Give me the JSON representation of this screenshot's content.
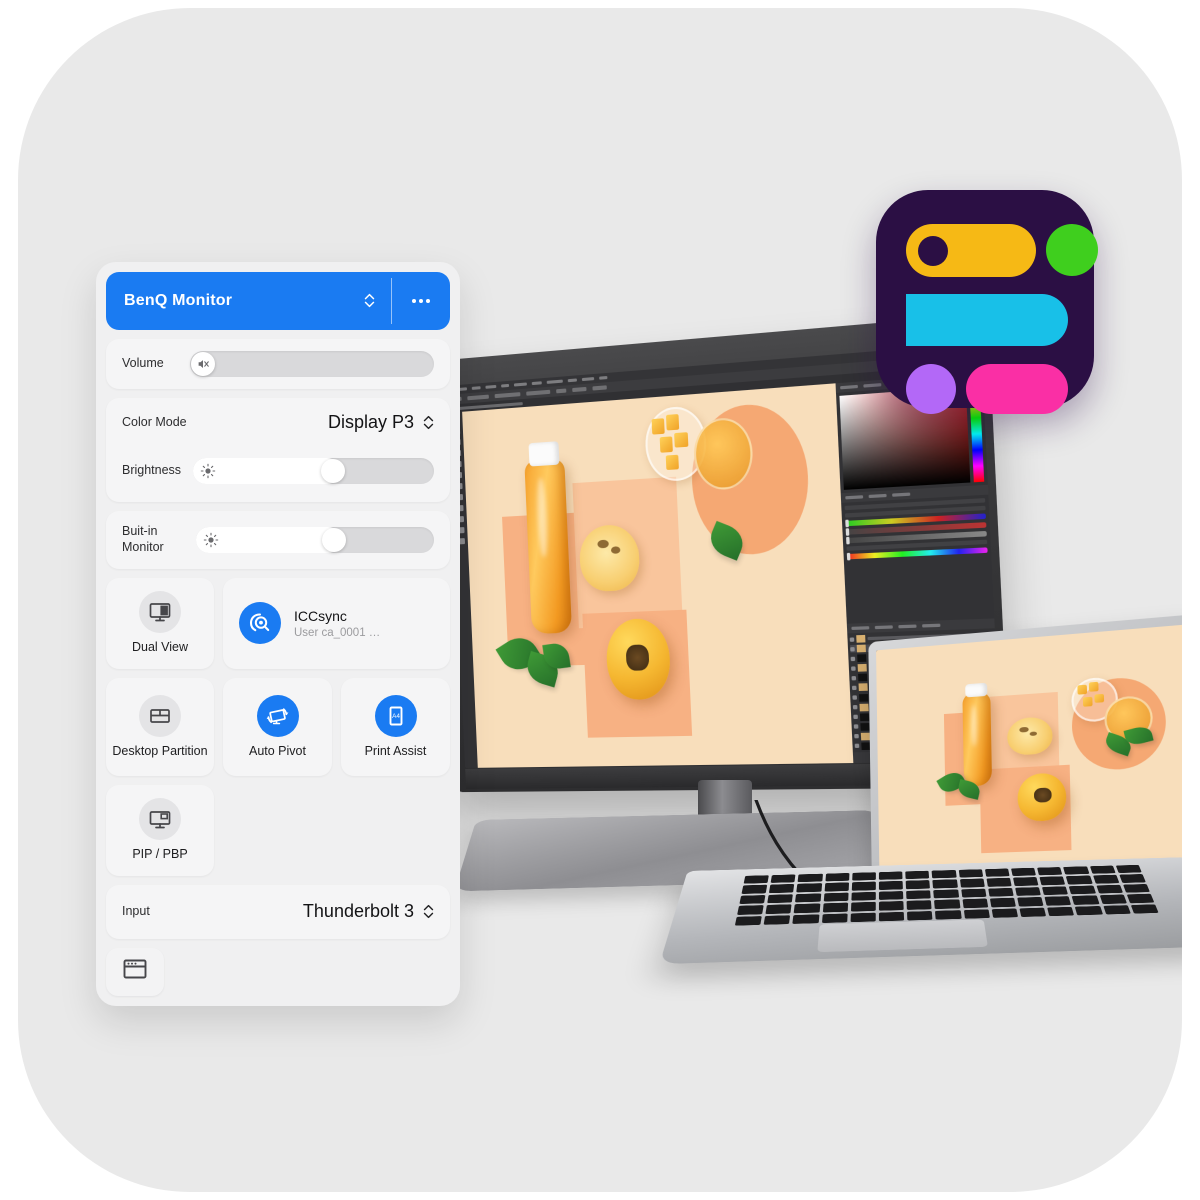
{
  "app": {
    "panel_title": "BenQ Monitor",
    "more_icon": "ellipsis-icon",
    "stepper_icon": "chevron-updown-icon"
  },
  "rows": {
    "volume": {
      "label": "Volume",
      "value_pct": 0,
      "knob_icon": "speaker-mute-icon"
    },
    "color_mode": {
      "label": "Color Mode",
      "value": "Display P3"
    },
    "brightness": {
      "label": "Brightness",
      "value_pct": 60,
      "knob_icon": "brightness-sun-icon"
    },
    "builtin_monitor": {
      "label": "Buit-in Monitor",
      "value_pct": 60,
      "knob_icon": "brightness-sun-icon"
    },
    "input": {
      "label": "Input",
      "value": "Thunderbolt 3"
    }
  },
  "tiles": {
    "dual_view": {
      "label": "Dual View",
      "icon": "dual-view-monitor-icon",
      "style": "grey"
    },
    "desktop_partition": {
      "label": "Desktop Partition",
      "icon": "desktop-partition-grid-icon",
      "style": "grey"
    },
    "pip_pbp": {
      "label": "PIP / PBP",
      "icon": "pip-pbp-monitor-icon",
      "style": "grey"
    },
    "auto_pivot": {
      "label": "Auto Pivot",
      "icon": "auto-pivot-rotate-icon",
      "style": "blue"
    },
    "print_assist": {
      "label": "Print Assist",
      "icon": "print-assist-a4-icon",
      "style": "blue",
      "glyph": "A4"
    }
  },
  "iccsync": {
    "title": "ICCsync",
    "subtitle": "User ca_0001 …",
    "icon": "iccsync-icon"
  },
  "footer": {
    "window_icon": "window-osd-icon"
  },
  "app_icon": {
    "name": "display-pilot-app-icon",
    "background": "#2b0f44",
    "shapes": [
      {
        "name": "yellow-toggle",
        "color": "#f6b915"
      },
      {
        "name": "green-dot",
        "color": "#3fcf1e"
      },
      {
        "name": "cyan-bar",
        "color": "#18c0e8"
      },
      {
        "name": "purple-dot",
        "color": "#b368f7"
      },
      {
        "name": "pink-pill",
        "color": "#fa2fa5"
      }
    ]
  },
  "devices": {
    "monitor": {
      "name": "desktop-monitor",
      "screen_content": "photo-editor-persimmon-juice"
    },
    "laptop": {
      "name": "laptop",
      "screen_content": "persimmon-juice-photo"
    }
  },
  "theme": {
    "accent": "#1a7bf2",
    "canvas_bg": "#e9e9e9",
    "panel_bg": "#f0f0f1",
    "card_bg": "#f5f5f6"
  }
}
